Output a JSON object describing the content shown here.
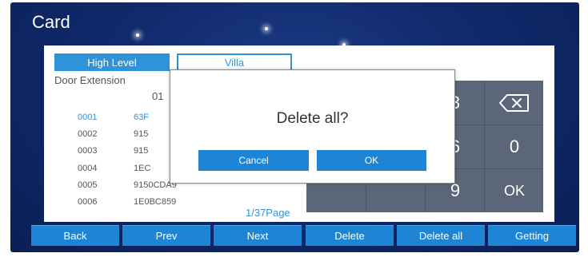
{
  "window": {
    "title": "Card"
  },
  "tabs": {
    "high_level": "High Level",
    "villa": "Villa"
  },
  "table": {
    "door_extension_label": "Door Extension",
    "column_value": "01",
    "rows": [
      {
        "num": "0001",
        "code": "63F",
        "selected": true
      },
      {
        "num": "0002",
        "code": "915"
      },
      {
        "num": "0003",
        "code": "915"
      },
      {
        "num": "0004",
        "code": "1EC"
      },
      {
        "num": "0005",
        "code": "9150CDA9"
      },
      {
        "num": "0006",
        "code": "1E0BC859"
      }
    ]
  },
  "keypad": {
    "keys": [
      {
        "label": "3"
      },
      {
        "label": "⌫",
        "icon": "backspace-icon"
      },
      {
        "label": "6"
      },
      {
        "label": "0"
      },
      {
        "label": "9"
      },
      {
        "label": "OK"
      }
    ]
  },
  "pagination": {
    "text": "1/37Page"
  },
  "dialog": {
    "message": "Delete all?",
    "cancel_label": "Cancel",
    "ok_label": "OK"
  },
  "buttons": {
    "back": "Back",
    "prev": "Prev",
    "next": "Next",
    "delete": "Delete",
    "delete_all": "Delete all",
    "getting": "Getting"
  },
  "colors": {
    "accent": "#1f84d4",
    "tab_active": "#2f93da",
    "background": "#102a6c",
    "keypad": "#5b6778"
  }
}
